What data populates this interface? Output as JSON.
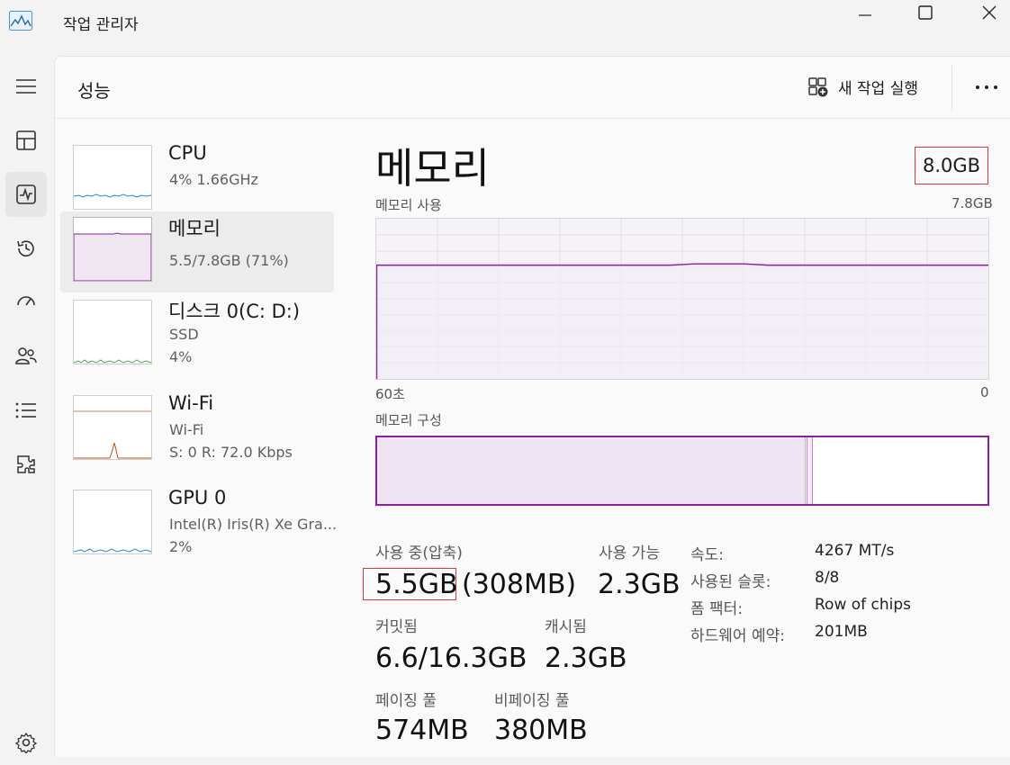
{
  "window": {
    "title": "작업 관리자"
  },
  "header": {
    "page_title": "성능",
    "new_task_label": "새 작업 실행"
  },
  "nav": [
    "menu-icon",
    "processes-icon",
    "performance-icon",
    "app-history-icon",
    "startup-icon",
    "users-icon",
    "details-icon",
    "services-icon",
    "settings-icon"
  ],
  "resources": [
    {
      "name": "CPU",
      "line1": "4%  1.66GHz",
      "line2": ""
    },
    {
      "name": "메모리",
      "line1": "5.5/7.8GB (71%)",
      "line2": ""
    },
    {
      "name": "디스크 0(C: D:)",
      "line1": "SSD",
      "line2": "4%"
    },
    {
      "name": "Wi-Fi",
      "line1": "Wi-Fi",
      "line2": "S:  0  R:  72.0 Kbps"
    },
    {
      "name": "GPU 0",
      "line1": "Intel(R) Iris(R) Xe Gra...",
      "line2": "2%"
    }
  ],
  "detail": {
    "title": "메모리",
    "total": "8.0GB",
    "usage_label": "메모리 사용",
    "usage_max": "7.8GB",
    "axis_left": "60초",
    "axis_right": "0",
    "composition_label": "메모리 구성",
    "composition": {
      "in_use_fraction": 0.7,
      "modified_fraction": 0.008
    },
    "usage_fraction": 0.71,
    "stats": {
      "in_use_label": "사용 중(압축)",
      "in_use_value": "5.5GB",
      "compressed_value": "(308MB)",
      "available_label": "사용 가능",
      "available_value": "2.3GB",
      "committed_label": "커밋됨",
      "committed_value": "6.6/16.3GB",
      "cached_label": "캐시됨",
      "cached_value": "2.3GB",
      "paged_label": "페이징 풀",
      "paged_value": "574MB",
      "nonpaged_label": "비페이징 풀",
      "nonpaged_value": "380MB"
    },
    "specs": [
      {
        "label": "속도:",
        "value": "4267 MT/s"
      },
      {
        "label": "사용된 슬롯:",
        "value": "8/8"
      },
      {
        "label": "폼 팩터:",
        "value": "Row of chips"
      },
      {
        "label": "하드웨어 예약:",
        "value": "201MB"
      }
    ]
  },
  "colors": {
    "memory_accent": "#8c1ea0",
    "cpu_accent": "#1e8ad6",
    "disk_accent": "#4ca84c",
    "wifi_accent": "#c0501a",
    "highlight": "#d83a3a"
  }
}
